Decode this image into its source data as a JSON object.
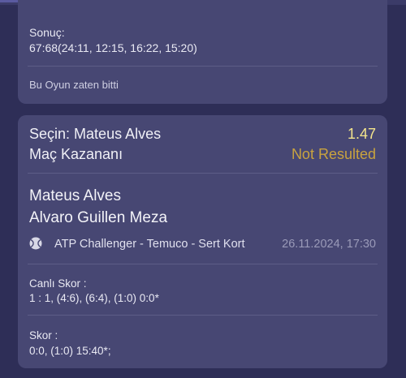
{
  "result_card": {
    "result_label": "Sonuç:",
    "result_value": "67:68(24:11, 12:15, 16:22, 15:20)",
    "game_over_text": "Bu Oyun zaten bitti"
  },
  "bet_card": {
    "selection_prefix": "Seçin:",
    "selection_name": "Mateus Alves",
    "odds": "1.47",
    "market": "Maç Kazananı",
    "status": "Not Resulted",
    "team1": "Mateus Alves",
    "team2": "Alvaro Guillen Meza",
    "sport_icon": "tennis-ball-icon",
    "tournament": "ATP Challenger - Temuco - Sert Kort",
    "datetime": "26.11.2024, 17:30",
    "live_score_label": "Canlı Skor :",
    "live_score_value": "1 : 1, (4:6), (6:4), (1:0) 0:0*",
    "score_label": "Skor :",
    "score_value": "0:0, (1:0) 15:40*;"
  },
  "colors": {
    "background": "#2e2e57",
    "card": "#474773",
    "odds": "#f4e58c",
    "status": "#c9a33f"
  }
}
